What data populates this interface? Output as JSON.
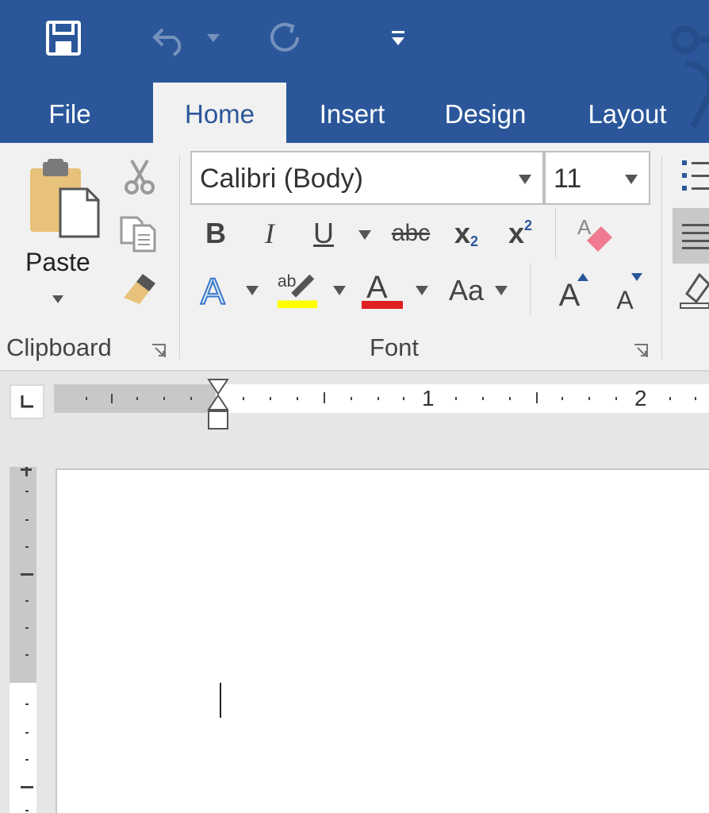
{
  "quick_access": {
    "save_icon": "save-icon",
    "undo_icon": "undo-icon",
    "redo_icon": "redo-icon",
    "customize_icon": "customize-quick-access-icon"
  },
  "tabs": [
    {
      "label": "File"
    },
    {
      "label": "Home"
    },
    {
      "label": "Insert"
    },
    {
      "label": "Design"
    },
    {
      "label": "Layout"
    }
  ],
  "clipboard": {
    "paste_label": "Paste",
    "group_label": "Clipboard"
  },
  "font": {
    "font_name": "Calibri (Body)",
    "font_size": "11",
    "group_label": "Font",
    "bold": "B",
    "italic": "I",
    "underline": "U",
    "strikethrough": "abc",
    "subscript": "x",
    "subscript_mark": "2",
    "superscript": "x",
    "superscript_mark": "2",
    "change_case": "Aa",
    "grow": "A",
    "shrink": "A",
    "font_color_hex": "#e02020",
    "highlight_hex": "#ffff00"
  },
  "ruler": {
    "marks": [
      "1",
      "2"
    ]
  },
  "colors": {
    "ribbon_blue": "#2b579a",
    "ribbon_bg": "#f1f1f1"
  }
}
